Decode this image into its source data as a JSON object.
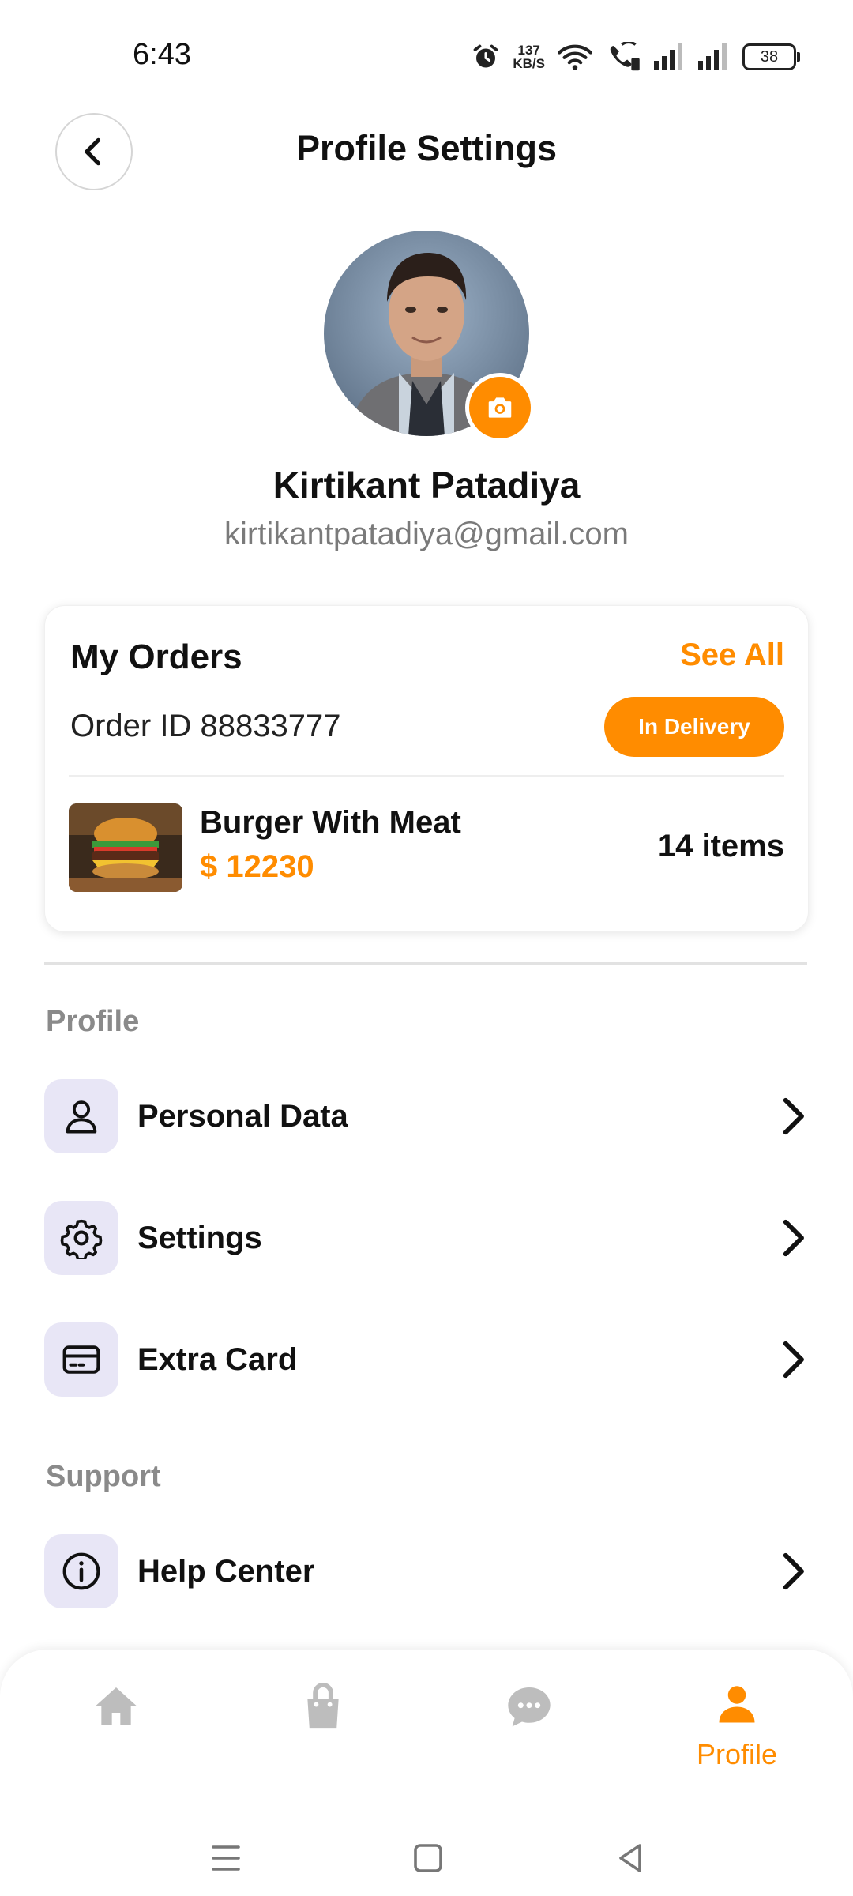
{
  "status_bar": {
    "time": "6:43",
    "net_speed_value": "137",
    "net_speed_unit": "KB/S",
    "battery": "38"
  },
  "header": {
    "title": "Profile Settings"
  },
  "profile": {
    "name": "Kirtikant Patadiya",
    "email": "kirtikantpatadiya@gmail.com"
  },
  "orders": {
    "title": "My Orders",
    "see_all": "See All",
    "order_id": "Order ID 88833777",
    "status": "In Delivery",
    "item_name": "Burger With Meat",
    "item_price": "$ 12230",
    "item_count": "14 items"
  },
  "sections": {
    "profile_title": "Profile",
    "support_title": "Support"
  },
  "menu": {
    "personal_data": "Personal Data",
    "settings": "Settings",
    "extra_card": "Extra Card",
    "help_center": "Help Center"
  },
  "bottom_nav": {
    "active_label": "Profile",
    "active_index": 3,
    "icons": [
      "home-icon",
      "bag-icon",
      "chat-icon",
      "profile-icon"
    ]
  },
  "colors": {
    "accent": "#ff8c00",
    "icon_bg": "#e8e6f6",
    "inactive_icon": "#bdbdbd",
    "muted_text": "#8a8a8a"
  }
}
